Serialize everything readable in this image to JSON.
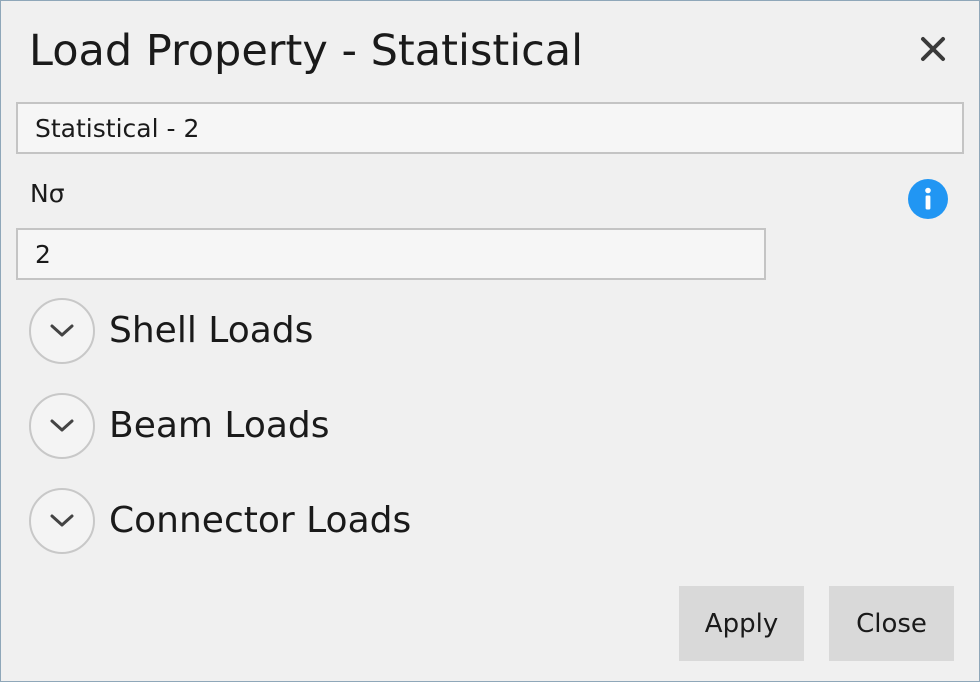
{
  "dialog": {
    "title": "Load Property - Statistical",
    "close_icon": "close-icon"
  },
  "name_field": {
    "value": "Statistical - 2"
  },
  "nsigma": {
    "label": "Nσ",
    "value": "2",
    "info_icon": "info-icon"
  },
  "sections": [
    {
      "label": "Shell Loads",
      "icon": "chevron-down-icon"
    },
    {
      "label": "Beam Loads",
      "icon": "chevron-down-icon"
    },
    {
      "label": "Connector Loads",
      "icon": "chevron-down-icon"
    }
  ],
  "buttons": {
    "apply_label": "Apply",
    "close_label": "Close"
  },
  "colors": {
    "info_blue": "#2196f3",
    "button_bg": "#d9d9d9",
    "border": "#c4c4c4",
    "background": "#f0f0f0"
  }
}
